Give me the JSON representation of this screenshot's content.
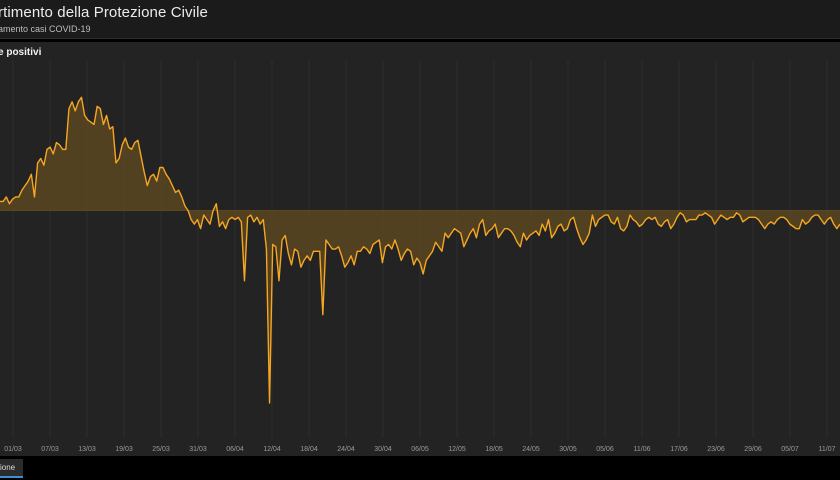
{
  "header": {
    "title": "rtimento della Protezione Civile",
    "subtitle": "amento casi COVID-19"
  },
  "panel": {
    "title": "e positivi"
  },
  "footer": {
    "tab_label": "ione"
  },
  "colors": {
    "line": "#f5a623",
    "fill": "#5a4621",
    "grid": "#2e2e2e",
    "tick_text": "#9a9a9a"
  },
  "chart_data": {
    "type": "area",
    "title": "",
    "xlabel": "",
    "ylabel": "",
    "x_tick_labels": [
      "01/03",
      "07/03",
      "13/03",
      "19/03",
      "25/03",
      "31/03",
      "06/04",
      "12/04",
      "18/04",
      "24/04",
      "30/04",
      "06/05",
      "12/05",
      "18/05",
      "24/05",
      "30/05",
      "05/06",
      "11/06",
      "17/06",
      "23/06",
      "29/06",
      "05/07",
      "11/07"
    ],
    "baseline": 0,
    "ylim": [
      -1000,
      700
    ],
    "grid": false,
    "series": [
      {
        "values": [
          40,
          40,
          60,
          30,
          50,
          60,
          60,
          90,
          110,
          130,
          160,
          60,
          210,
          230,
          200,
          270,
          280,
          250,
          300,
          290,
          270,
          270,
          450,
          480,
          440,
          480,
          500,
          420,
          400,
          390,
          380,
          460,
          450,
          380,
          420,
          360,
          370,
          210,
          230,
          290,
          320,
          280,
          270,
          300,
          310,
          240,
          170,
          110,
          150,
          160,
          130,
          190,
          190,
          160,
          140,
          110,
          80,
          90,
          60,
          20,
          0,
          -40,
          -60,
          -40,
          -80,
          -20,
          -40,
          -60,
          0,
          30,
          -70,
          -50,
          -80,
          -40,
          -30,
          -40,
          -30,
          -50,
          -310,
          -30,
          -20,
          -50,
          -30,
          -60,
          -40,
          -170,
          -850,
          -150,
          -160,
          -310,
          -130,
          -110,
          -190,
          -240,
          -170,
          -180,
          -250,
          -220,
          -200,
          -220,
          -180,
          -180,
          -180,
          -460,
          -130,
          -150,
          -170,
          -170,
          -160,
          -200,
          -250,
          -230,
          -200,
          -240,
          -180,
          -180,
          -160,
          -170,
          -190,
          -150,
          -140,
          -130,
          -230,
          -160,
          -150,
          -170,
          -130,
          -170,
          -220,
          -190,
          -170,
          -180,
          -240,
          -210,
          -230,
          -280,
          -220,
          -200,
          -180,
          -140,
          -160,
          -180,
          -100,
          -120,
          -100,
          -80,
          -90,
          -100,
          -160,
          -130,
          -100,
          -80,
          -120,
          -60,
          -40,
          -110,
          -90,
          -80,
          -60,
          -120,
          -100,
          -80,
          -80,
          -90,
          -110,
          -140,
          -160,
          -100,
          -130,
          -110,
          -100,
          -90,
          -110,
          -60,
          -90,
          -40,
          -120,
          -100,
          -70,
          -60,
          -90,
          -80,
          -40,
          -30,
          -80,
          -120,
          -150,
          -130,
          -100,
          -20,
          -70,
          -40,
          -30,
          -20,
          -20,
          -50,
          -60,
          -30,
          -80,
          -90,
          -70,
          -20,
          -40,
          -50,
          -70,
          -60,
          -40,
          -30,
          -40,
          -30,
          -60,
          -70,
          -50,
          -40,
          -80,
          -60,
          -30,
          -10,
          -20,
          -50,
          -40,
          -40,
          -40,
          -20,
          -20,
          -10,
          -20,
          -30,
          -60,
          -40,
          -20,
          -30,
          -40,
          -30,
          -30,
          -10,
          -20,
          -50,
          -40,
          -30,
          -30,
          -30,
          -40,
          -60,
          -80,
          -60,
          -50,
          -60,
          -40,
          -30,
          -30,
          -40,
          -60,
          -70,
          -80,
          -80,
          -40,
          -60,
          -50,
          -30,
          -20,
          -20,
          -40,
          -60,
          -40,
          -30,
          -60,
          -80,
          -60
        ]
      }
    ]
  }
}
